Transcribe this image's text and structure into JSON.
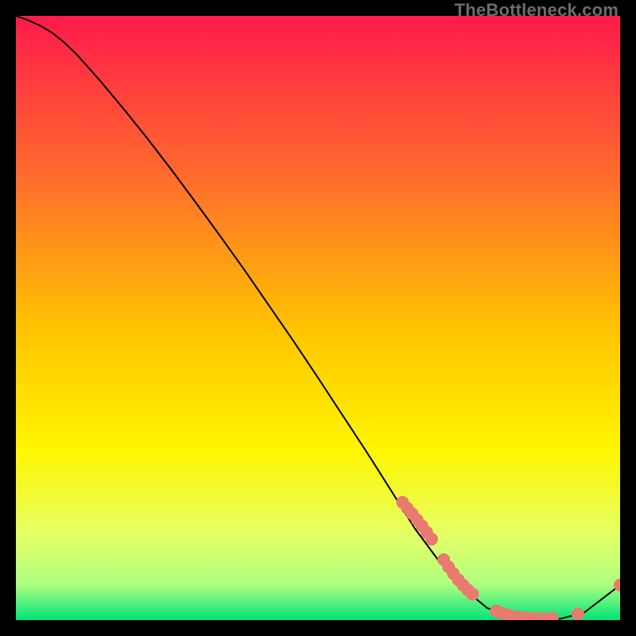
{
  "watermark": "TheBottleneck.com",
  "chart_data": {
    "type": "line",
    "title": "",
    "xlabel": "",
    "ylabel": "",
    "xlim": [
      0,
      100
    ],
    "ylim": [
      0,
      100
    ],
    "background_gradient": {
      "top": "#ff1a4b",
      "mid1": "#ff7a2e",
      "mid2": "#ffd400",
      "mid3": "#e8ff5a",
      "bottom": "#00e57a"
    },
    "line_color": "#000000",
    "line": {
      "x": [
        0,
        2,
        4,
        6,
        8,
        10,
        14,
        18,
        22,
        26,
        30,
        34,
        38,
        42,
        46,
        50,
        54,
        58,
        62,
        66,
        70,
        74,
        78,
        82,
        86,
        90,
        94,
        100
      ],
      "y": [
        100,
        99.3,
        98.4,
        97.2,
        95.6,
        93.7,
        89.2,
        84.4,
        79.4,
        74.2,
        68.8,
        63.3,
        57.7,
        51.9,
        46.1,
        40.1,
        34.0,
        27.9,
        21.6,
        15.2,
        9.8,
        5.3,
        2.0,
        0.6,
        0.2,
        0.2,
        1.2,
        5.8
      ]
    },
    "dot_color": "#e97a6f",
    "dot_radius": 8,
    "dots": [
      {
        "x": 64.0,
        "y": 19.5
      },
      {
        "x": 64.8,
        "y": 18.5
      },
      {
        "x": 65.6,
        "y": 17.6
      },
      {
        "x": 66.4,
        "y": 16.6
      },
      {
        "x": 67.2,
        "y": 15.6
      },
      {
        "x": 68.0,
        "y": 14.5
      },
      {
        "x": 68.8,
        "y": 13.4
      },
      {
        "x": 70.8,
        "y": 10.0
      },
      {
        "x": 71.6,
        "y": 8.8
      },
      {
        "x": 72.4,
        "y": 7.7
      },
      {
        "x": 73.2,
        "y": 6.7
      },
      {
        "x": 74.0,
        "y": 5.8
      },
      {
        "x": 74.8,
        "y": 5.0
      },
      {
        "x": 75.6,
        "y": 4.3
      },
      {
        "x": 79.5,
        "y": 1.5
      },
      {
        "x": 80.2,
        "y": 1.2
      },
      {
        "x": 80.9,
        "y": 1.0
      },
      {
        "x": 81.6,
        "y": 0.8
      },
      {
        "x": 82.8,
        "y": 0.55
      },
      {
        "x": 83.5,
        "y": 0.45
      },
      {
        "x": 84.3,
        "y": 0.35
      },
      {
        "x": 85.0,
        "y": 0.3
      },
      {
        "x": 85.8,
        "y": 0.25
      },
      {
        "x": 86.5,
        "y": 0.22
      },
      {
        "x": 87.3,
        "y": 0.22
      },
      {
        "x": 88.0,
        "y": 0.25
      },
      {
        "x": 88.8,
        "y": 0.3
      },
      {
        "x": 93.0,
        "y": 1.0
      },
      {
        "x": 100.0,
        "y": 5.8
      }
    ]
  }
}
